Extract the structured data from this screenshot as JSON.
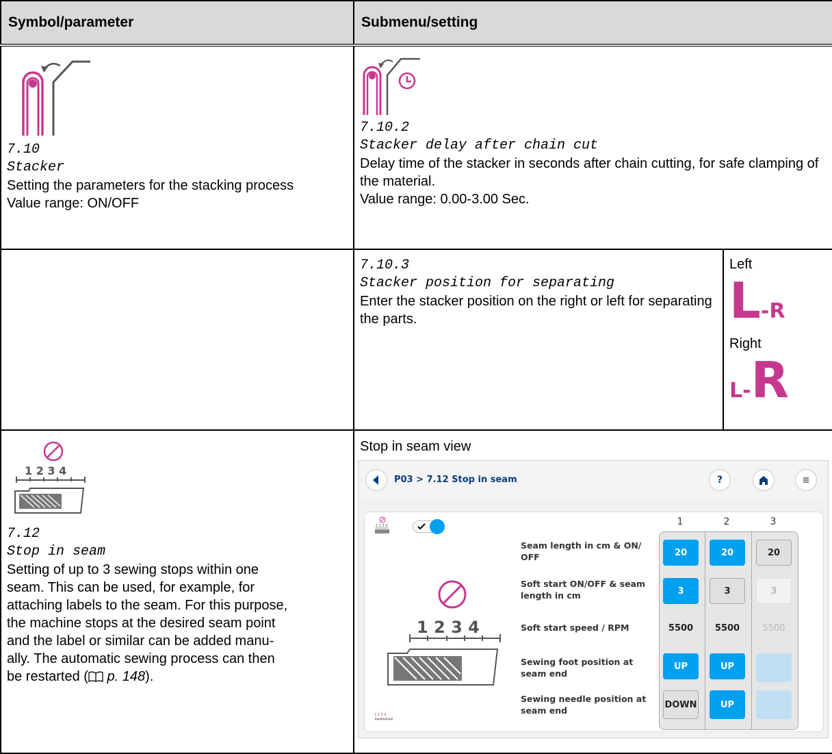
{
  "header": {
    "col1": "Symbol/parameter",
    "col2": "Submenu/setting"
  },
  "row1": {
    "left": {
      "code": "7.10",
      "name": "Stacker",
      "desc": "Setting the parameters for the stacking process",
      "range": "Value range: ON/OFF"
    },
    "right": {
      "code": "7.10.2",
      "name": "Stacker delay after chain cut",
      "desc": "Delay time of the stacker in seconds after chain cutting, for safe clamping of the material.",
      "range": "Value range: 0.00-3.00 Sec."
    }
  },
  "row2": {
    "code": "7.10.3",
    "name": "Stacker position for separating",
    "desc": "Enter the stacker position on the right or left for separating the parts.",
    "left_label": "Left",
    "right_label": "Right",
    "left_symbol": {
      "big": "L",
      "small": "-R"
    },
    "right_symbol": {
      "small": "L-",
      "big": "R"
    }
  },
  "row3": {
    "left": {
      "ruler_numbers": "1 2 3 4",
      "code": "7.12",
      "name": "Stop in seam",
      "desc_lines": [
        "Setting of up to 3 sewing stops within one",
        "seam. This can be used, for example, for",
        "attaching labels to the seam. For this purpose,",
        "the machine stops at the desired seam point",
        "and the label or similar can be added manu-",
        "ally. The automatic sewing process can then",
        "be restarted ("
      ],
      "ref": "p. 148",
      "ref_close": ")."
    },
    "right": {
      "view_title": "Stop in seam view"
    }
  },
  "screen": {
    "breadcrumb": "P03 > 7.12 Stop in seam",
    "help": "?",
    "columns": [
      "1",
      "2",
      "3"
    ],
    "ruler_numbers": "1 2 3 4",
    "rows": [
      {
        "label": "Seam length in cm & ON/ OFF",
        "values": [
          "20",
          "20",
          "20"
        ]
      },
      {
        "label": "Soft start ON/OFF & seam length in cm",
        "values": [
          "3",
          "3",
          "3"
        ]
      },
      {
        "label": "Soft start speed / RPM",
        "values": [
          "5500",
          "5500",
          "5500"
        ]
      },
      {
        "label": "Sewing foot position at seam end",
        "values": [
          "UP",
          "UP",
          ""
        ]
      },
      {
        "label": "Sewing needle position at seam end",
        "values": [
          "DOWN",
          "UP",
          ""
        ]
      }
    ],
    "toggle_on": true
  },
  "colors": {
    "accent_pink": "#c6388f",
    "screen_blue": "#00a0f0",
    "header_grey": "#d9d9d9"
  }
}
